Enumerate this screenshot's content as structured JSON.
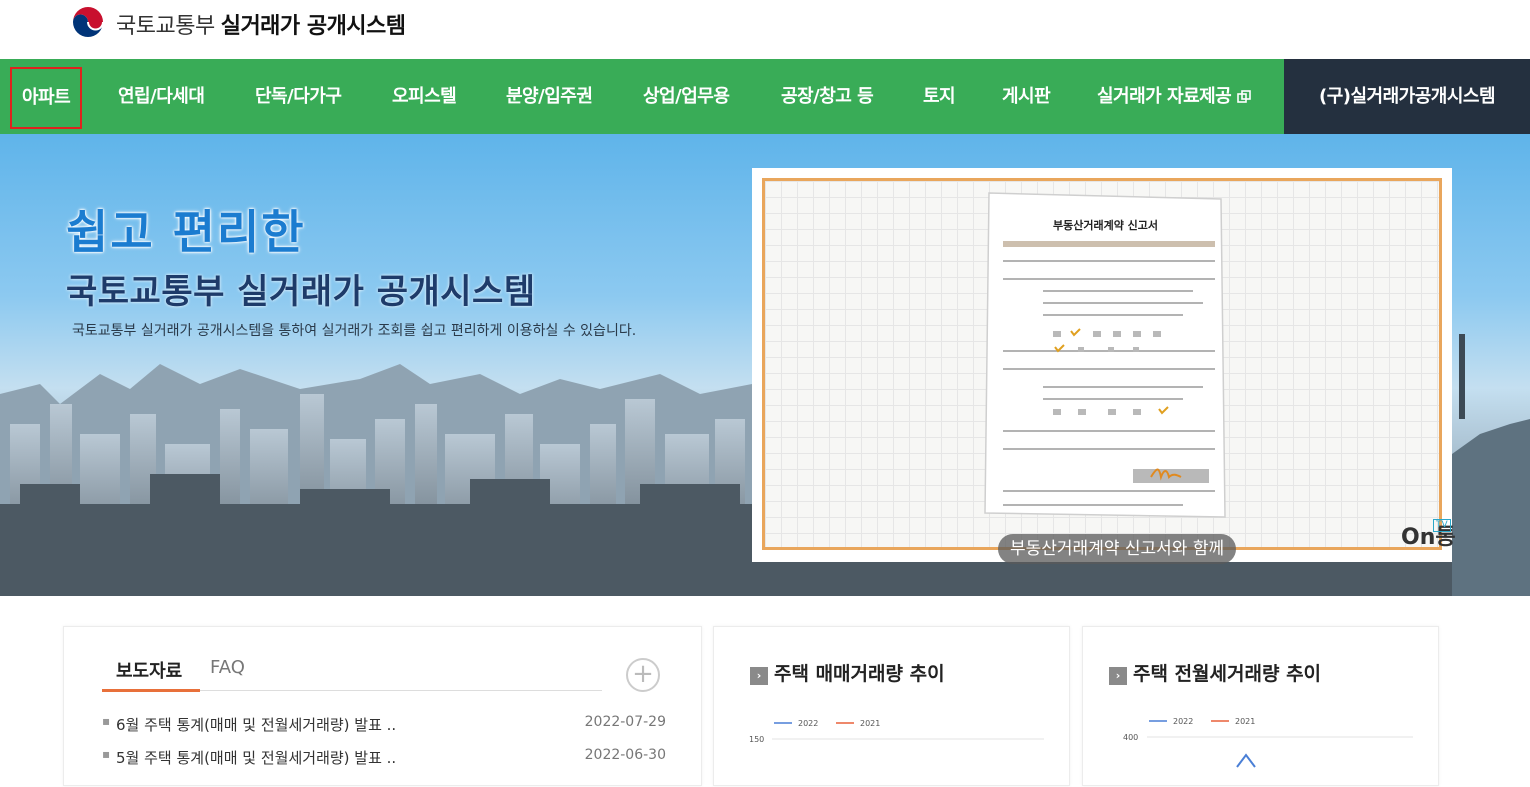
{
  "header": {
    "org_name": "국토교통부",
    "system_name": "실거래가 공개시스템"
  },
  "nav": {
    "items": [
      {
        "label": "아파트"
      },
      {
        "label": "연립/다세대"
      },
      {
        "label": "단독/다가구"
      },
      {
        "label": "오피스텔"
      },
      {
        "label": "분양/입주권"
      },
      {
        "label": "상업/업무용"
      },
      {
        "label": "공장/창고 등"
      },
      {
        "label": "토지"
      },
      {
        "label": "게시판"
      },
      {
        "label": "실거래가 자료제공"
      }
    ],
    "old_system": "(구)실거래가공개시스템",
    "active_index": 0,
    "colors": {
      "nav_bg": "#39ac57",
      "old_bg": "#24303f",
      "active_border": "#e0221e"
    }
  },
  "hero": {
    "headline1": "쉽고 편리한",
    "headline2": "국토교통부 실거래가 공개시스템",
    "description": "국토교통부 실거래가 공개시스템을 통하여 실거래가 조회를 쉽고 편리하게 이용하실 수 있습니다.",
    "video": {
      "doc_title": "부동산거래계약 신고서",
      "caption": "부동산거래계약 신고서와 함께",
      "channel_logo": "On통",
      "channel_badge": "TV"
    }
  },
  "news": {
    "tabs": [
      "보도자료",
      "FAQ"
    ],
    "more_icon": "plus-icon",
    "items": [
      {
        "title": "6월 주택 통계(매매 및 전월세거래량) 발표 ..",
        "date": "2022-07-29"
      },
      {
        "title": "5월 주택 통계(매매 및 전월세거래량) 발표 ..",
        "date": "2022-06-30"
      }
    ]
  },
  "charts": [
    {
      "title": "주택 매매거래량 추이",
      "chart_data": {
        "type": "line",
        "series": [
          {
            "name": "2022",
            "color": "#4a7fd6"
          },
          {
            "name": "2021",
            "color": "#e8603a"
          }
        ],
        "y_tick_visible": 150
      }
    },
    {
      "title": "주택 전월세거래량 추이",
      "chart_data": {
        "type": "line",
        "series": [
          {
            "name": "2022",
            "color": "#4a7fd6"
          },
          {
            "name": "2021",
            "color": "#e8603a"
          }
        ],
        "y_tick_visible": 400
      }
    }
  ]
}
